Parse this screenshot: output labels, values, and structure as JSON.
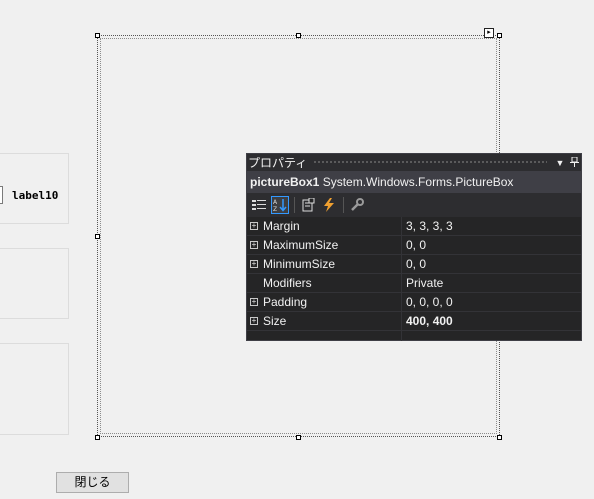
{
  "form": {
    "label10": "label10",
    "close_button": "閉じる"
  },
  "properties_window": {
    "title": "プロパティ",
    "object_name": "pictureBox1",
    "object_type": "System.Windows.Forms.PictureBox",
    "toolbar": [
      {
        "icon": "categorized-icon",
        "active": false
      },
      {
        "icon": "alphabetical-icon",
        "active": true
      },
      {
        "icon": "properties-icon",
        "active": false
      },
      {
        "icon": "events-icon",
        "active": false
      },
      {
        "icon": "property-pages-icon",
        "active": false
      }
    ],
    "rows": [
      {
        "name": "Margin",
        "value": "3, 3, 3, 3",
        "expandable": true,
        "bold": false
      },
      {
        "name": "MaximumSize",
        "value": "0, 0",
        "expandable": true,
        "bold": false
      },
      {
        "name": "MinimumSize",
        "value": "0, 0",
        "expandable": true,
        "bold": false
      },
      {
        "name": "Modifiers",
        "value": "Private",
        "expandable": false,
        "bold": false
      },
      {
        "name": "Padding",
        "value": "0, 0, 0, 0",
        "expandable": true,
        "bold": false
      },
      {
        "name": "Size",
        "value": "400, 400",
        "expandable": true,
        "bold": true
      }
    ],
    "colors": {
      "background": "#252526",
      "header": "#3f3f46",
      "text": "#f1f1f1",
      "active_border": "#3399ff"
    }
  }
}
